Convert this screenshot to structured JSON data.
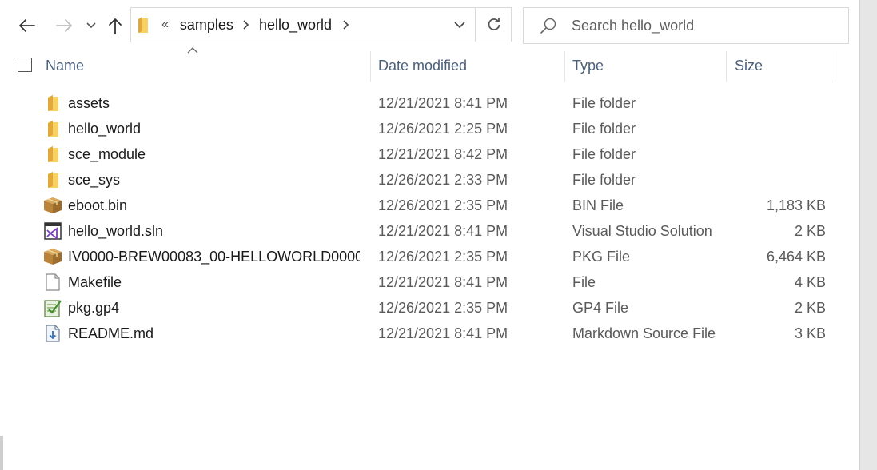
{
  "toolbar": {
    "back_icon": "arrow-left-icon",
    "forward_icon": "arrow-right-icon",
    "recent_icon": "chevron-down-icon",
    "up_icon": "arrow-up-icon"
  },
  "address_bar": {
    "overflow": "«",
    "breadcrumbs": [
      "samples",
      "hello_world"
    ],
    "refresh_icon": "refresh-icon"
  },
  "search": {
    "placeholder": "Search hello_world"
  },
  "columns": {
    "name": "Name",
    "date_modified": "Date modified",
    "type": "Type",
    "size": "Size"
  },
  "files": [
    {
      "name": "assets",
      "date": "12/21/2021 8:41 PM",
      "type": "File folder",
      "size": "",
      "icon": "folder-icon"
    },
    {
      "name": "hello_world",
      "date": "12/26/2021 2:25 PM",
      "type": "File folder",
      "size": "",
      "icon": "folder-icon"
    },
    {
      "name": "sce_module",
      "date": "12/21/2021 8:42 PM",
      "type": "File folder",
      "size": "",
      "icon": "folder-icon"
    },
    {
      "name": "sce_sys",
      "date": "12/26/2021 2:33 PM",
      "type": "File folder",
      "size": "",
      "icon": "folder-icon"
    },
    {
      "name": "eboot.bin",
      "date": "12/26/2021 2:35 PM",
      "type": "BIN File",
      "size": "1,183 KB",
      "icon": "package-icon"
    },
    {
      "name": "hello_world.sln",
      "date": "12/21/2021 8:41 PM",
      "type": "Visual Studio Solution",
      "size": "2 KB",
      "icon": "visual-studio-solution-icon"
    },
    {
      "name": "IV0000-BREW00083_00-HELLOWORLD0000...",
      "date": "12/26/2021 2:35 PM",
      "type": "PKG File",
      "size": "6,464 KB",
      "icon": "package-icon"
    },
    {
      "name": "Makefile",
      "date": "12/21/2021 8:41 PM",
      "type": "File",
      "size": "4 KB",
      "icon": "blank-file-icon"
    },
    {
      "name": "pkg.gp4",
      "date": "12/26/2021 2:35 PM",
      "type": "GP4 File",
      "size": "2 KB",
      "icon": "gp4-file-icon"
    },
    {
      "name": "README.md",
      "date": "12/21/2021 8:41 PM",
      "type": "Markdown Source File",
      "size": "3 KB",
      "icon": "markdown-file-icon"
    }
  ],
  "colors": {
    "header_text": "#4c607a",
    "folder_yellow": "#f8d162",
    "border": "#d9d9d9"
  }
}
